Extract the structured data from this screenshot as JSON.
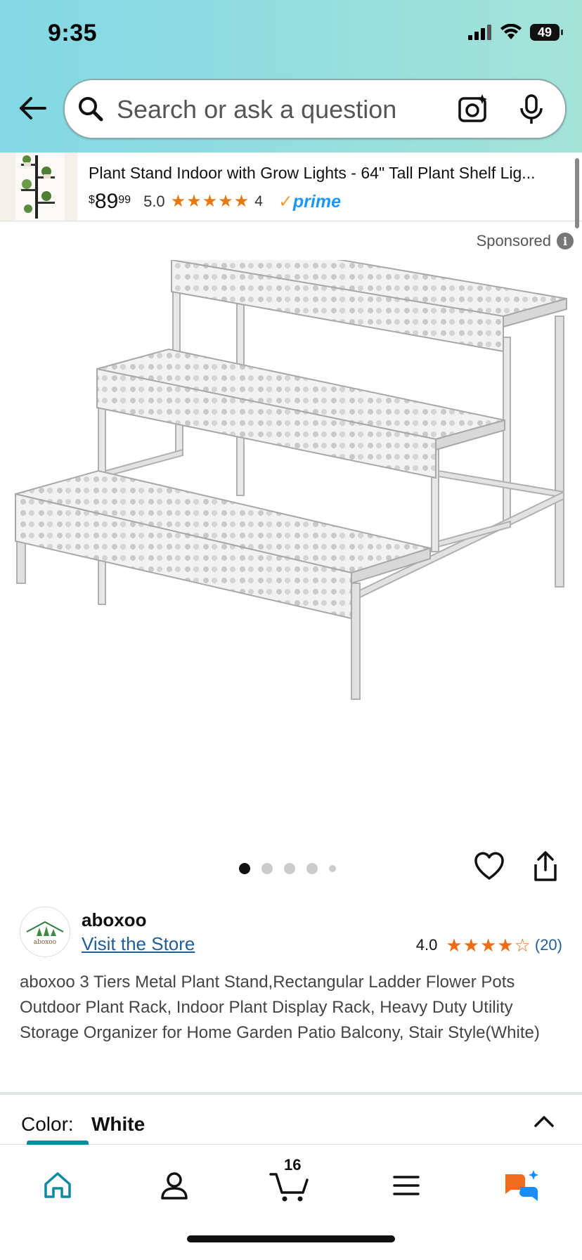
{
  "status_bar": {
    "time": "9:35",
    "battery": "49"
  },
  "search": {
    "placeholder": "Search or ask a question"
  },
  "ad": {
    "title": "Plant Stand Indoor with Grow Lights - 64\" Tall Plant Shelf Lig...",
    "price_symbol": "$",
    "price_whole": "89",
    "price_fraction": "99",
    "rating": "5.0",
    "rating_stars": 5,
    "review_count": "4",
    "prime_label": "prime",
    "star_color": "#e47911"
  },
  "sponsored": {
    "label": "Sponsored",
    "info_icon": "info-icon"
  },
  "carousel": {
    "total": 5,
    "active_index": 0
  },
  "product": {
    "brand": "aboxoo",
    "store_link": "Visit the Store",
    "rating": "4.0",
    "rating_stars": 4,
    "review_count": "(20)",
    "title": "aboxoo 3 Tiers Metal Plant Stand,Rectangular Ladder Flower Pots Outdoor Plant Rack, Indoor Plant Display Rack, Heavy Duty Utility Storage Organizer for Home Garden Patio Balcony, Stair Style(White)",
    "star_color": "#ee6d14"
  },
  "color_selector": {
    "label": "Color:",
    "value": "White"
  },
  "bottom_nav": {
    "cart_count": "16",
    "accent": "#0a8aa0"
  },
  "colors": {
    "topbar_start": "#82d8e3",
    "topbar_end": "#a5e3d7",
    "link": "#1f5e99",
    "prime": "#1a98ff"
  }
}
